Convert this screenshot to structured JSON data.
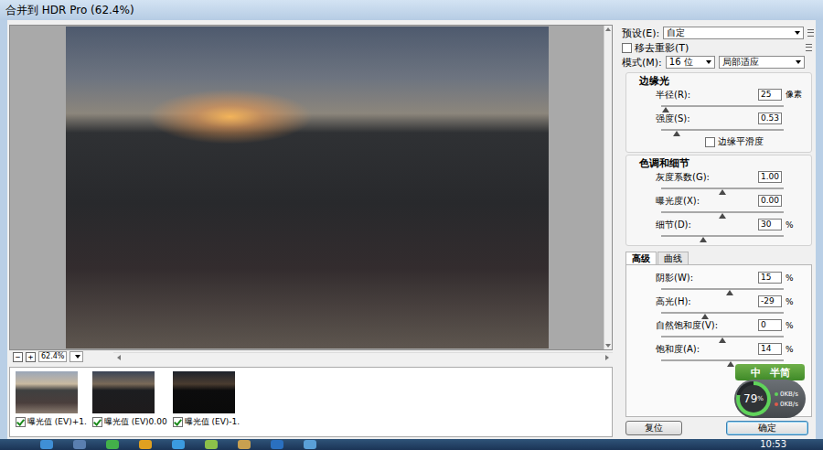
{
  "window": {
    "title": "合并到 HDR Pro (62.4%)"
  },
  "preview": {
    "zoom": "62.4%",
    "zoom_out": "−",
    "zoom_in": "+"
  },
  "sources": [
    {
      "label": "曝光值 (EV)+1.",
      "checked": true
    },
    {
      "label": "曝光值 (EV)0.00",
      "checked": true
    },
    {
      "label": "曝光值 (EV)-1.",
      "checked": true
    }
  ],
  "preset": {
    "label": "预设(E):",
    "value": "自定"
  },
  "remove_ghosts": {
    "label": "移去重影(T)",
    "checked": false
  },
  "mode": {
    "label": "模式(M):",
    "depth": "16 位",
    "method": "局部适应"
  },
  "groups": [
    {
      "title": "边缘光",
      "rows": [
        {
          "kind": "slider",
          "label": "半径(R):",
          "value": "25",
          "unit": "像素",
          "level": 0.04
        },
        {
          "kind": "slider",
          "label": "强度(S):",
          "value": "0.53",
          "unit": "",
          "level": 0.13
        },
        {
          "kind": "checkbox",
          "label": "边缘平滑度",
          "checked": false
        }
      ]
    },
    {
      "title": "色调和细节",
      "rows": [
        {
          "kind": "slider",
          "label": "灰度系数(G):",
          "value": "1.00",
          "unit": "",
          "level": 0.5
        },
        {
          "kind": "slider",
          "label": "曝光度(X):",
          "value": "0.00",
          "unit": "",
          "level": 0.5
        },
        {
          "kind": "slider",
          "label": "细节(D):",
          "value": "30",
          "unit": "%",
          "level": 0.34
        }
      ]
    }
  ],
  "tabs": [
    {
      "label": "高级",
      "selected": true
    },
    {
      "label": "曲线",
      "selected": false
    }
  ],
  "advanced": {
    "rows": [
      {
        "kind": "slider",
        "label": "阴影(W):",
        "value": "15",
        "unit": "%",
        "level": 0.56
      },
      {
        "kind": "slider",
        "label": "高光(H):",
        "value": "-29",
        "unit": "%",
        "level": 0.36
      },
      {
        "kind": "slider",
        "label": "自然饱和度(V):",
        "value": "0",
        "unit": "%",
        "level": 0.5
      },
      {
        "kind": "slider",
        "label": "饱和度(A):",
        "value": "14",
        "unit": "%",
        "level": 0.57
      }
    ]
  },
  "buttons": [
    {
      "label": "复位",
      "default": false
    },
    {
      "label": "确定",
      "default": true
    }
  ],
  "ime": {
    "lang": "中",
    "mode": "半简"
  },
  "netmon": {
    "value": "79",
    "unit": "%",
    "level": 0.79,
    "up": "0KB/s",
    "down": "0KB/s"
  },
  "taskbar": {
    "time": "10:53"
  }
}
